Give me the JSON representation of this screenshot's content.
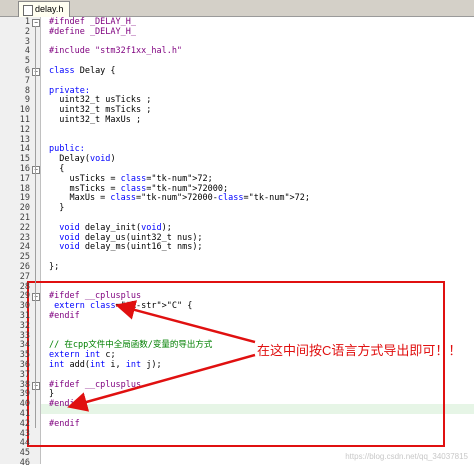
{
  "tab": {
    "title": "delay.h"
  },
  "lines": [
    {
      "n": "1",
      "t": "#ifndef _DELAY_H_",
      "c": "pp"
    },
    {
      "n": "2",
      "t": "#define _DELAY_H_",
      "c": "pp"
    },
    {
      "n": "3",
      "t": "",
      "c": ""
    },
    {
      "n": "4",
      "t": "#include \"stm32f1xx_hal.h\"",
      "c": "pp"
    },
    {
      "n": "5",
      "t": "",
      "c": ""
    },
    {
      "n": "6",
      "t": "class Delay {",
      "c": "mix"
    },
    {
      "n": "7",
      "t": "",
      "c": ""
    },
    {
      "n": "8",
      "t": "private:",
      "c": "kw"
    },
    {
      "n": "9",
      "t": "  uint32_t usTicks ;",
      "c": ""
    },
    {
      "n": "10",
      "t": "  uint32_t msTicks ;",
      "c": ""
    },
    {
      "n": "11",
      "t": "  uint32_t MaxUs ;",
      "c": ""
    },
    {
      "n": "12",
      "t": "",
      "c": ""
    },
    {
      "n": "13",
      "t": "",
      "c": ""
    },
    {
      "n": "14",
      "t": "public:",
      "c": "kw"
    },
    {
      "n": "15",
      "t": "  Delay(void)",
      "c": "mix"
    },
    {
      "n": "16",
      "t": "  {",
      "c": ""
    },
    {
      "n": "17",
      "t": "    usTicks = 72;",
      "c": "mix"
    },
    {
      "n": "18",
      "t": "    msTicks = 72000;",
      "c": "mix"
    },
    {
      "n": "19",
      "t": "    MaxUs = 72000-72;",
      "c": "mix"
    },
    {
      "n": "20",
      "t": "  }",
      "c": ""
    },
    {
      "n": "21",
      "t": "",
      "c": ""
    },
    {
      "n": "22",
      "t": "  void delay_init(void);",
      "c": "mix"
    },
    {
      "n": "23",
      "t": "  void delay_us(uint32_t nus);",
      "c": "mix"
    },
    {
      "n": "24",
      "t": "  void delay_ms(uint16_t nms);",
      "c": "mix"
    },
    {
      "n": "25",
      "t": "",
      "c": ""
    },
    {
      "n": "26",
      "t": "};",
      "c": ""
    },
    {
      "n": "27",
      "t": "",
      "c": ""
    },
    {
      "n": "28",
      "t": "",
      "c": ""
    },
    {
      "n": "29",
      "t": "#ifdef __cplusplus",
      "c": "pp"
    },
    {
      "n": "30",
      "t": " extern \"C\" {",
      "c": "mix"
    },
    {
      "n": "31",
      "t": "#endif",
      "c": "pp"
    },
    {
      "n": "32",
      "t": "",
      "c": ""
    },
    {
      "n": "33",
      "t": "",
      "c": ""
    },
    {
      "n": "34",
      "t": "// 在cpp文件中全局函数/变量的导出方式",
      "c": "cm"
    },
    {
      "n": "35",
      "t": "extern int c;",
      "c": "mix"
    },
    {
      "n": "36",
      "t": "int add(int i, int j);",
      "c": "mix"
    },
    {
      "n": "37",
      "t": "",
      "c": ""
    },
    {
      "n": "38",
      "t": "#ifdef __cplusplus",
      "c": "pp"
    },
    {
      "n": "39",
      "t": "}",
      "c": ""
    },
    {
      "n": "40",
      "t": "#endif",
      "c": "pp"
    },
    {
      "n": "41",
      "t": "",
      "c": ""
    },
    {
      "n": "42",
      "t": "#endif",
      "c": "pp"
    },
    {
      "n": "43",
      "t": "",
      "c": ""
    },
    {
      "n": "44",
      "t": "",
      "c": ""
    },
    {
      "n": "45",
      "t": "",
      "c": ""
    },
    {
      "n": "46",
      "t": "",
      "c": ""
    }
  ],
  "annotation": {
    "text": "在这中间按C语言方式导出即可！！",
    "color": "#e01010"
  },
  "watermark": "https://blog.csdn.net/qq_34037815",
  "colors": {
    "keyword": "#0000ff",
    "preprocessor": "#7f007f",
    "number": "#00a0a0",
    "comment": "#008000",
    "highlight": "#e6f5e6"
  }
}
